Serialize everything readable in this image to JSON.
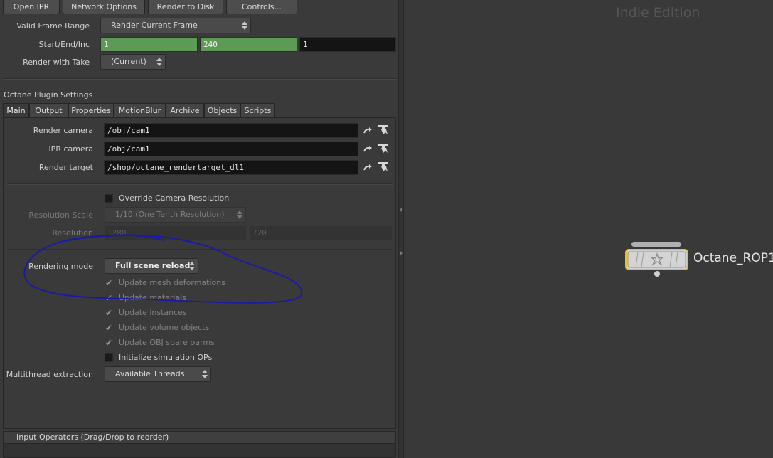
{
  "toolbar": {
    "open_ipr": "Open IPR",
    "network_options": "Network Options",
    "render_to_disk": "Render to Disk",
    "controls": "Controls..."
  },
  "frame": {
    "valid_range_label": "Valid Frame Range",
    "valid_range_value": "Render Current Frame",
    "start_end_inc_label": "Start/End/Inc",
    "start": "1",
    "end": "240",
    "inc": "1",
    "take_label": "Render with Take",
    "take_value": "(Current)"
  },
  "plugin_settings_title": "Octane Plugin Settings",
  "tabs": [
    {
      "label": "Main",
      "active": true
    },
    {
      "label": "Output"
    },
    {
      "label": "Properties"
    },
    {
      "label": "MotionBlur"
    },
    {
      "label": "Archive"
    },
    {
      "label": "Objects"
    },
    {
      "label": "Scripts"
    }
  ],
  "main": {
    "render_camera_label": "Render camera",
    "render_camera_value": "/obj/cam1",
    "ipr_camera_label": "IPR camera",
    "ipr_camera_value": "/obj/cam1",
    "render_target_label": "Render target",
    "render_target_value": "/shop/octane_rendertarget_dl1",
    "override_cam_res_label": "Override Camera Resolution",
    "resolution_scale_label": "Resolution Scale",
    "resolution_scale_value": "1/10 (One Tenth Resolution)",
    "resolution_label": "Resolution",
    "resolution_x": "1280",
    "resolution_y": "720",
    "rendering_mode_label": "Rendering mode",
    "rendering_mode_value": "Full scene reload",
    "updates": [
      "Update mesh deformations",
      "Update materials",
      "Update instances",
      "Update volume objects",
      "Update OBJ spare parms"
    ],
    "init_sim_label": "Initialize simulation OPs",
    "multithread_label": "Multithread extraction",
    "multithread_value": "Available Threads"
  },
  "input_operators_label": "Input Operators (Drag/Drop to reorder)",
  "network": {
    "edition_watermark": "Indie Edition",
    "node_name": "Octane_ROP1"
  },
  "colors": {
    "annotation": "#1a1aa8",
    "node_highlight": "#e8c21a",
    "field_green": "#5d9a55"
  }
}
